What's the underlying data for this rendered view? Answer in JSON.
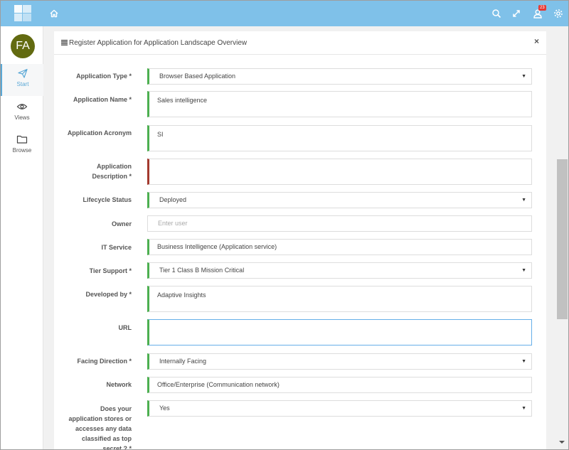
{
  "header": {
    "notification_count": "23",
    "icons": [
      "home-icon",
      "search-icon",
      "expand-icon",
      "user-icon",
      "gear-icon"
    ]
  },
  "sidebar": {
    "avatar_initials": "FA",
    "avatar_color": "#626a10",
    "items": [
      {
        "label": "Start",
        "icon": "paper-plane-icon",
        "active": true
      },
      {
        "label": "Views",
        "icon": "eye-icon",
        "active": false
      },
      {
        "label": "Browse",
        "icon": "folder-icon",
        "active": false
      }
    ]
  },
  "form": {
    "title": "Register Application for Application Landscape Overview",
    "fields": [
      {
        "label": "Application Type *",
        "type": "select",
        "value": "Browser Based Application"
      },
      {
        "label": "Application Name *",
        "type": "textarea",
        "value": "Sales intelligence"
      },
      {
        "label": "Application Acronym",
        "type": "textarea",
        "value": "SI"
      },
      {
        "label": "Application Description *",
        "type": "textarea",
        "value": "",
        "state": "error"
      },
      {
        "label": "Lifecycle Status",
        "type": "select",
        "value": "Deployed"
      },
      {
        "label": "Owner",
        "type": "input",
        "value": "",
        "placeholder": "Enter user"
      },
      {
        "label": "IT Service",
        "type": "input",
        "value": "Business Intelligence (Application service)"
      },
      {
        "label": "Tier Support *",
        "type": "select",
        "value": "Tier 1 Class B Mission Critical"
      },
      {
        "label": "Developed by *",
        "type": "textarea",
        "value": "Adaptive Insights"
      },
      {
        "label": "URL",
        "type": "textarea",
        "value": "",
        "state": "focused"
      },
      {
        "label": "Facing Direction *",
        "type": "select",
        "value": "Internally Facing"
      },
      {
        "label": "Network",
        "type": "input",
        "value": "Office/Enterprise (Communication network)"
      },
      {
        "label": "Does your application stores or accesses any data classified as top secret ? *",
        "type": "select",
        "value": "Yes"
      }
    ]
  },
  "colors": {
    "topbar": "#7fc1e9",
    "valid": "#4caf50",
    "invalid": "#a33a2f",
    "badge": "#e53935",
    "active_nav": "#5aa8d6"
  }
}
